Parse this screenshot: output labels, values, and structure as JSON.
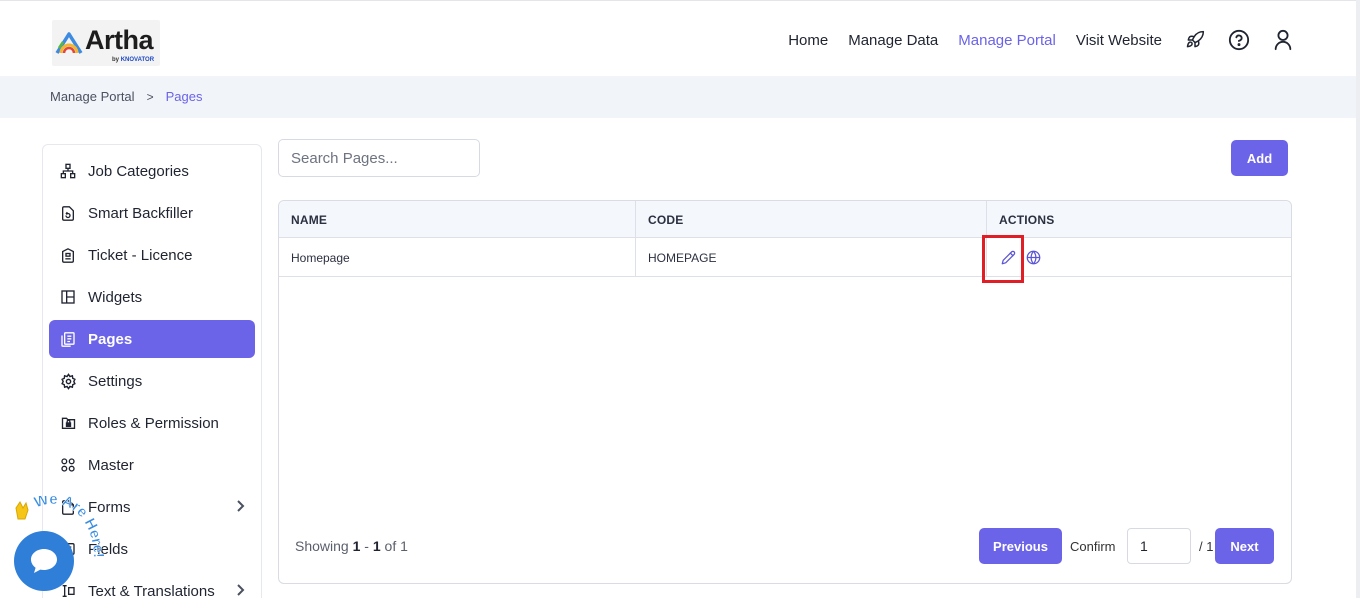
{
  "header": {
    "logo_text": "Artha",
    "logo_sub_prefix": "by",
    "logo_sub_brand": "KNOVATOR",
    "nav": [
      {
        "label": "Home"
      },
      {
        "label": "Manage Data"
      },
      {
        "label": "Manage Portal"
      },
      {
        "label": "Visit Website"
      }
    ],
    "active_nav": "Manage Portal",
    "icons": [
      "rocket-icon",
      "help-icon",
      "user-icon"
    ]
  },
  "breadcrumb": {
    "items": [
      "Manage Portal",
      "Pages"
    ],
    "separator": ">"
  },
  "sidebar": {
    "items": [
      {
        "label": "Job Categories",
        "icon": "sitemap-icon"
      },
      {
        "label": "Smart Backfiller",
        "icon": "file-refresh-icon"
      },
      {
        "label": "Ticket - Licence",
        "icon": "ticket-icon"
      },
      {
        "label": "Widgets",
        "icon": "layout-icon"
      },
      {
        "label": "Pages",
        "icon": "pages-icon"
      },
      {
        "label": "Settings",
        "icon": "gear-icon"
      },
      {
        "label": "Roles & Permission",
        "icon": "lock-folder-icon"
      },
      {
        "label": "Master",
        "icon": "grid-icon"
      },
      {
        "label": "Forms",
        "icon": "form-icon"
      },
      {
        "label": "Fields",
        "icon": "fields-icon"
      },
      {
        "label": "Text & Translations",
        "icon": "translate-icon"
      }
    ],
    "active": "Pages"
  },
  "main": {
    "search_placeholder": "Search Pages...",
    "add_label": "Add",
    "table": {
      "columns": [
        "NAME",
        "CODE",
        "ACTIONS"
      ],
      "rows": [
        {
          "name": "Homepage",
          "code": "HOMEPAGE",
          "actions": [
            "edit-icon",
            "globe-icon"
          ]
        }
      ]
    },
    "pagination": {
      "showing_prefix": "Showing",
      "from": "1",
      "dash": "-",
      "to": "1",
      "of_text": "of 1",
      "previous_label": "Previous",
      "confirm_label": "Confirm",
      "page_value": "1",
      "total_label": "/ 1",
      "next_label": "Next"
    }
  },
  "chat": {
    "badge_text": "We Are Here!"
  },
  "colors": {
    "accent": "#6b63e8",
    "breadcrumb_bg": "#f1f4f9",
    "highlight": "#e01e26",
    "chat": "#2f7fd8"
  }
}
